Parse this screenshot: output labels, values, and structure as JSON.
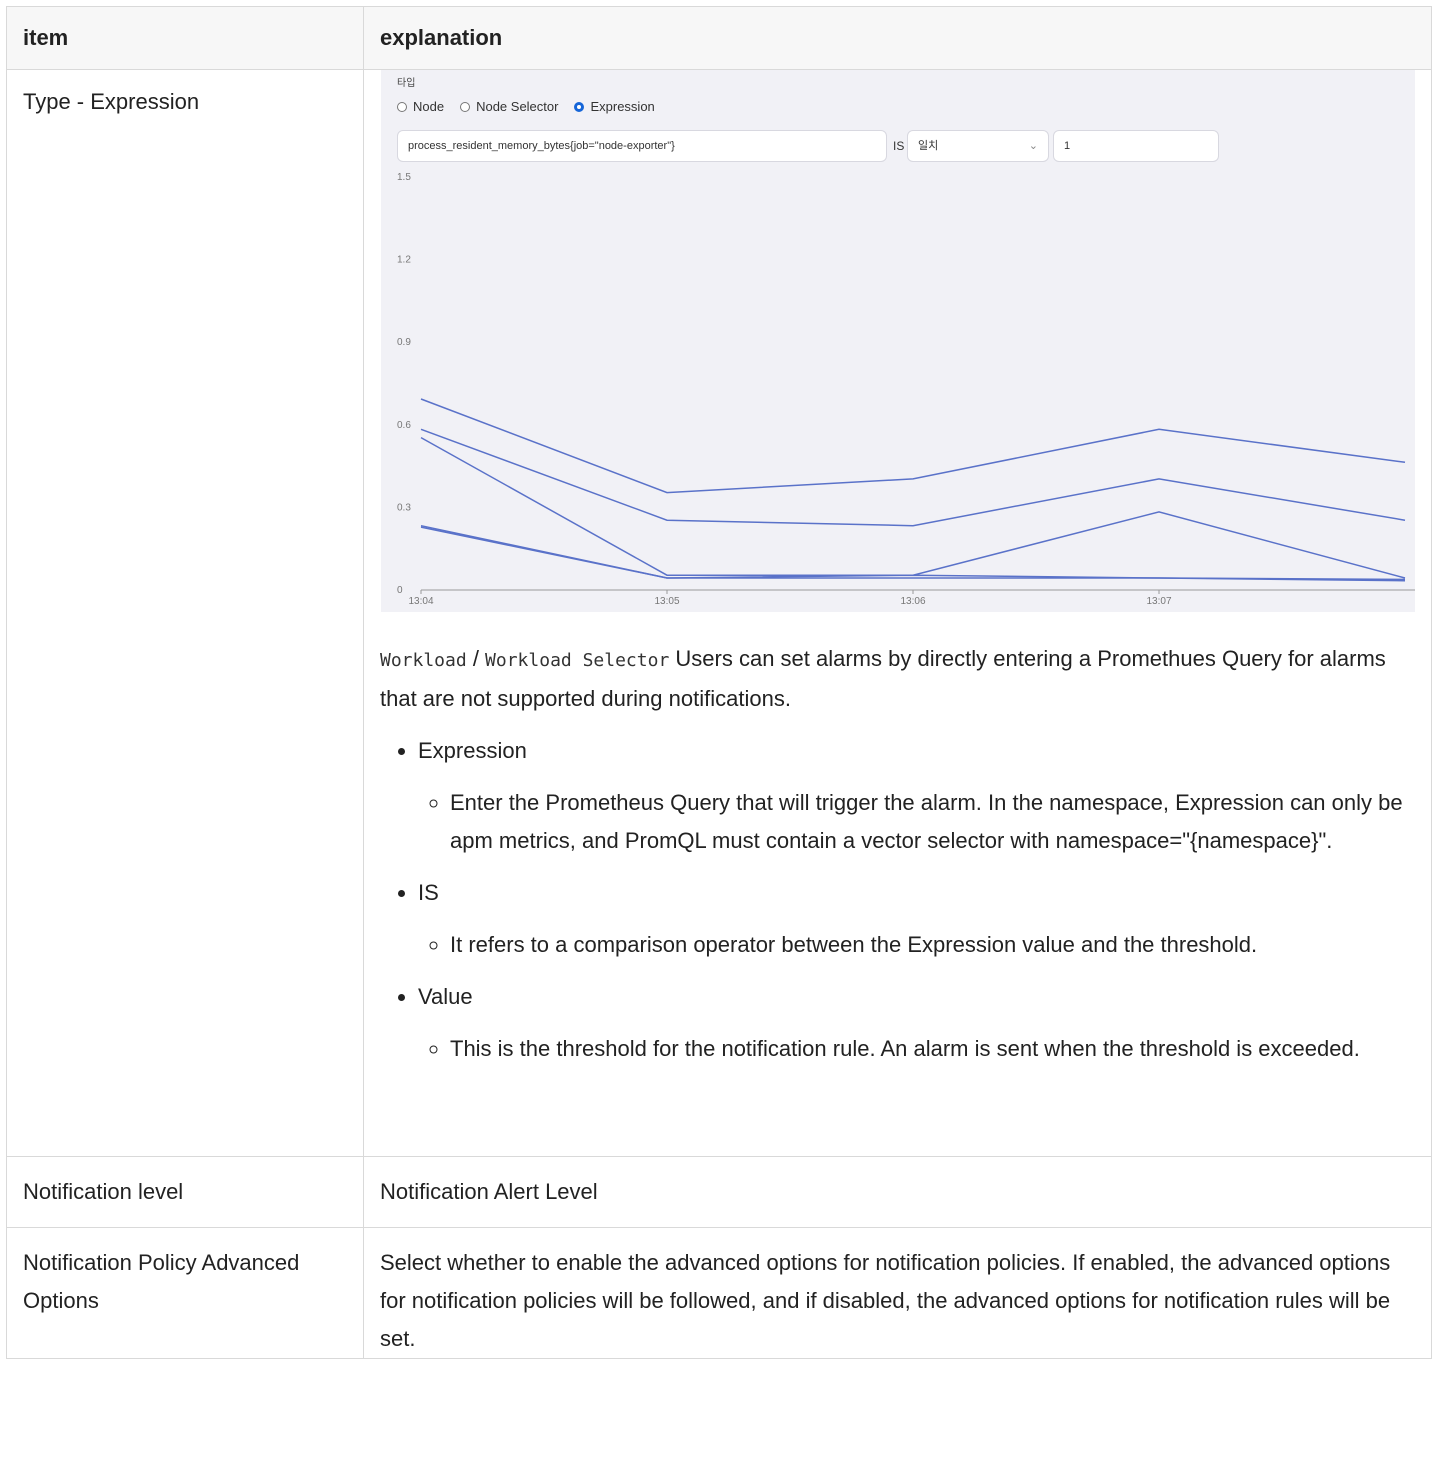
{
  "table": {
    "headers": {
      "item": "item",
      "explanation": "explanation"
    },
    "rows": [
      {
        "item": "Type - Expression",
        "screenshot": {
          "type_label": "타입",
          "radios": [
            {
              "label": "Node",
              "selected": false
            },
            {
              "label": "Node Selector",
              "selected": false
            },
            {
              "label": "Expression",
              "selected": true
            }
          ],
          "expression_value": "process_resident_memory_bytes{job=\"node-exporter\"}",
          "is_label": "IS",
          "operator_value": "일치",
          "threshold_value": "1"
        },
        "intro_code_1": "Workload",
        "intro_sep": " / ",
        "intro_code_2": "Workload Selector",
        "intro_text": " Users can set alarms by directly entering a Promethues Query for alarms that are not supported during notifications.",
        "bullets": [
          {
            "title": "Expression",
            "sub": "Enter the Prometheus Query that will trigger the alarm. In the namespace, Expression can only be apm metrics, and PromQL must contain a vector selector with namespace=\"{namespace}\"."
          },
          {
            "title": "IS",
            "sub": "It refers to a comparison operator between the Expression value and the threshold."
          },
          {
            "title": "Value",
            "sub": "This is the threshold for the notification rule. An alarm is sent when the threshold is exceeded."
          }
        ]
      },
      {
        "item": "Notification level",
        "explanation": "Notification Alert Level"
      },
      {
        "item": "Notification Policy Advanced Options",
        "explanation": "Select whether to enable the advanced options for notification policies. If enabled, the advanced options for notification policies will be followed, and if disabled, the advanced options for notification rules will be set."
      }
    ]
  },
  "chart_data": {
    "type": "line",
    "x": [
      "13:04",
      "13:05",
      "13:06",
      "13:07",
      ""
    ],
    "xticks": [
      "13:04",
      "13:05",
      "13:06",
      "13:07"
    ],
    "yticks": [
      "1.5",
      "1.2",
      "0.9",
      "0.6",
      "0.3",
      "0"
    ],
    "ylim": [
      0,
      1.5
    ],
    "series": [
      {
        "values": [
          0.69,
          0.35,
          0.4,
          0.58,
          0.46
        ]
      },
      {
        "values": [
          0.58,
          0.25,
          0.23,
          0.4,
          0.25
        ]
      },
      {
        "values": [
          0.55,
          0.05,
          0.05,
          0.28,
          0.04
        ]
      },
      {
        "values": [
          0.23,
          0.04,
          0.05,
          0.04,
          0.035
        ]
      },
      {
        "values": [
          0.225,
          0.04,
          0.04,
          0.04,
          0.03
        ]
      }
    ],
    "line_color": "#5a72c9",
    "grid": false
  }
}
